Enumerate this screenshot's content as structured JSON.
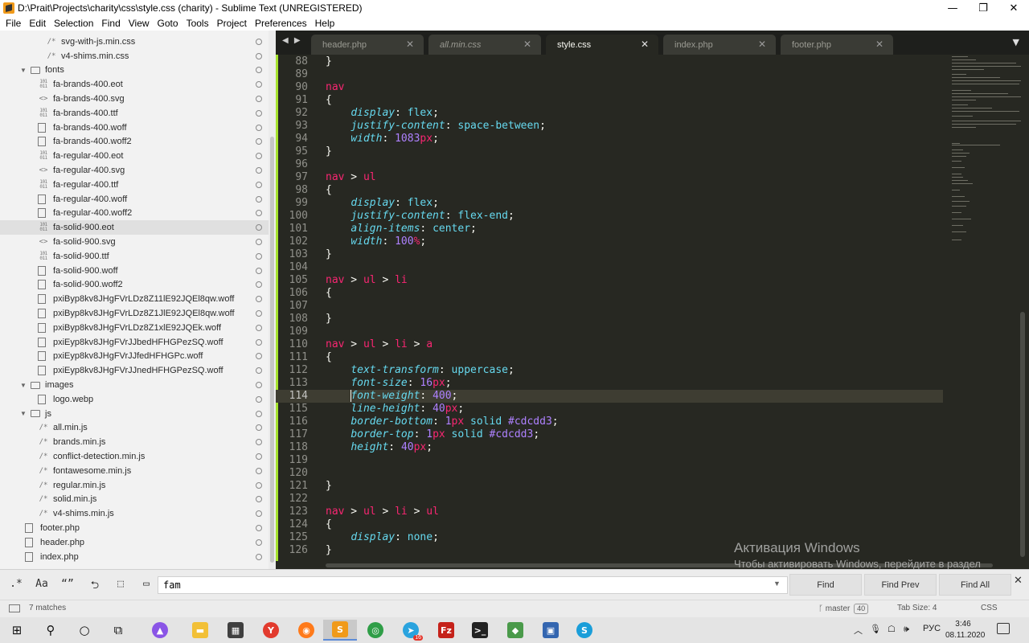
{
  "window": {
    "title": "D:\\Prait\\Projects\\charity\\css\\style.css (charity) - Sublime Text (UNREGISTERED)",
    "controls": [
      {
        "name": "minimize-button",
        "glyph": "—"
      },
      {
        "name": "maximize-button",
        "glyph": "❐"
      },
      {
        "name": "close-window-button",
        "glyph": "✕"
      }
    ]
  },
  "menu": [
    "File",
    "Edit",
    "Selection",
    "Find",
    "View",
    "Goto",
    "Tools",
    "Project",
    "Preferences",
    "Help"
  ],
  "sidebar": {
    "items": [
      {
        "label": "svg-with-js.min.css",
        "icon": "comment-file-icon",
        "glyph": "/*",
        "depth": 3
      },
      {
        "label": "v4-shims.min.css",
        "icon": "comment-file-icon",
        "glyph": "/*",
        "depth": 3
      },
      {
        "label": "fonts",
        "icon": "folder-icon",
        "type": "folder",
        "depth": 1
      },
      {
        "label": "fa-brands-400.eot",
        "icon": "binary-file-icon",
        "type": "bin",
        "depth": 2
      },
      {
        "label": "fa-brands-400.svg",
        "icon": "code-file-icon",
        "glyph": "<>",
        "depth": 2
      },
      {
        "label": "fa-brands-400.ttf",
        "icon": "binary-file-icon",
        "type": "bin",
        "depth": 2
      },
      {
        "label": "fa-brands-400.woff",
        "icon": "file-icon",
        "type": "doc",
        "depth": 2
      },
      {
        "label": "fa-brands-400.woff2",
        "icon": "file-icon",
        "type": "doc",
        "depth": 2
      },
      {
        "label": "fa-regular-400.eot",
        "icon": "binary-file-icon",
        "type": "bin",
        "depth": 2
      },
      {
        "label": "fa-regular-400.svg",
        "icon": "code-file-icon",
        "glyph": "<>",
        "depth": 2
      },
      {
        "label": "fa-regular-400.ttf",
        "icon": "binary-file-icon",
        "type": "bin",
        "depth": 2
      },
      {
        "label": "fa-regular-400.woff",
        "icon": "file-icon",
        "type": "doc",
        "depth": 2
      },
      {
        "label": "fa-regular-400.woff2",
        "icon": "file-icon",
        "type": "doc",
        "depth": 2
      },
      {
        "label": "fa-solid-900.eot",
        "icon": "binary-file-icon",
        "type": "bin",
        "depth": 2,
        "selected": true
      },
      {
        "label": "fa-solid-900.svg",
        "icon": "code-file-icon",
        "glyph": "<>",
        "depth": 2
      },
      {
        "label": "fa-solid-900.ttf",
        "icon": "binary-file-icon",
        "type": "bin",
        "depth": 2
      },
      {
        "label": "fa-solid-900.woff",
        "icon": "file-icon",
        "type": "doc",
        "depth": 2
      },
      {
        "label": "fa-solid-900.woff2",
        "icon": "file-icon",
        "type": "doc",
        "depth": 2
      },
      {
        "label": "pxiByp8kv8JHgFVrLDz8Z11lE92JQEl8qw.woff",
        "icon": "file-icon",
        "type": "doc",
        "depth": 2
      },
      {
        "label": "pxiByp8kv8JHgFVrLDz8Z1JlE92JQEl8qw.woff",
        "icon": "file-icon",
        "type": "doc",
        "depth": 2
      },
      {
        "label": "pxiByp8kv8JHgFVrLDz8Z1xlE92JQEk.woff",
        "icon": "file-icon",
        "type": "doc",
        "depth": 2
      },
      {
        "label": "pxiEyp8kv8JHgFVrJJbedHFHGPezSQ.woff",
        "icon": "file-icon",
        "type": "doc",
        "depth": 2
      },
      {
        "label": "pxiEyp8kv8JHgFVrJJfedHFHGPc.woff",
        "icon": "file-icon",
        "type": "doc",
        "depth": 2
      },
      {
        "label": "pxiEyp8kv8JHgFVrJJnedHFHGPezSQ.woff",
        "icon": "file-icon",
        "type": "doc",
        "depth": 2
      },
      {
        "label": "images",
        "icon": "folder-icon",
        "type": "folder",
        "depth": 1
      },
      {
        "label": "logo.webp",
        "icon": "file-icon",
        "type": "doc",
        "depth": 2
      },
      {
        "label": "js",
        "icon": "folder-icon",
        "type": "folder",
        "depth": 1
      },
      {
        "label": "all.min.js",
        "icon": "comment-file-icon",
        "glyph": "/*",
        "depth": 2
      },
      {
        "label": "brands.min.js",
        "icon": "comment-file-icon",
        "glyph": "/*",
        "depth": 2
      },
      {
        "label": "conflict-detection.min.js",
        "icon": "comment-file-icon",
        "glyph": "/*",
        "depth": 2
      },
      {
        "label": "fontawesome.min.js",
        "icon": "comment-file-icon",
        "glyph": "/*",
        "depth": 2
      },
      {
        "label": "regular.min.js",
        "icon": "comment-file-icon",
        "glyph": "/*",
        "depth": 2
      },
      {
        "label": "solid.min.js",
        "icon": "comment-file-icon",
        "glyph": "/*",
        "depth": 2
      },
      {
        "label": "v4-shims.min.js",
        "icon": "comment-file-icon",
        "glyph": "/*",
        "depth": 2
      },
      {
        "label": "footer.php",
        "icon": "file-icon",
        "type": "doc",
        "depth": 1
      },
      {
        "label": "header.php",
        "icon": "file-icon",
        "type": "doc",
        "depth": 1
      },
      {
        "label": "index.php",
        "icon": "file-icon",
        "type": "doc",
        "depth": 1
      }
    ]
  },
  "tabs": [
    {
      "label": "header.php",
      "active": false,
      "italic": false
    },
    {
      "label": "all.min.css",
      "active": false,
      "italic": true
    },
    {
      "label": "style.css",
      "active": true,
      "italic": false
    },
    {
      "label": "index.php",
      "active": false,
      "italic": false
    },
    {
      "label": "footer.php",
      "active": false,
      "italic": false
    }
  ],
  "tab_nav": "◀ ▶",
  "tab_close_glyph": "✕",
  "tab_dropdown_glyph": "▼",
  "editor": {
    "current_line": "114",
    "lines": [
      {
        "n": "88",
        "t": [
          [
            "p",
            "}"
          ]
        ]
      },
      {
        "n": "89",
        "t": []
      },
      {
        "n": "90",
        "t": [
          [
            "s",
            "nav"
          ]
        ]
      },
      {
        "n": "91",
        "t": [
          [
            "p",
            "{"
          ]
        ]
      },
      {
        "n": "92",
        "t": [
          [
            "p",
            "    "
          ],
          [
            "k",
            "display"
          ],
          [
            "p",
            ": "
          ],
          [
            "v",
            "flex"
          ],
          [
            "p",
            ";"
          ]
        ]
      },
      {
        "n": "93",
        "t": [
          [
            "p",
            "    "
          ],
          [
            "k",
            "justify-content"
          ],
          [
            "p",
            ": "
          ],
          [
            "v",
            "space-between"
          ],
          [
            "p",
            ";"
          ]
        ]
      },
      {
        "n": "94",
        "t": [
          [
            "p",
            "    "
          ],
          [
            "k",
            "width"
          ],
          [
            "p",
            ": "
          ],
          [
            "n",
            "1083"
          ],
          [
            "u",
            "px"
          ],
          [
            "p",
            ";"
          ]
        ]
      },
      {
        "n": "95",
        "t": [
          [
            "p",
            "}"
          ]
        ]
      },
      {
        "n": "96",
        "t": []
      },
      {
        "n": "97",
        "t": [
          [
            "s",
            "nav"
          ],
          [
            "p",
            " > "
          ],
          [
            "s",
            "ul"
          ]
        ]
      },
      {
        "n": "98",
        "t": [
          [
            "p",
            "{"
          ]
        ]
      },
      {
        "n": "99",
        "t": [
          [
            "p",
            "    "
          ],
          [
            "k",
            "display"
          ],
          [
            "p",
            ": "
          ],
          [
            "v",
            "flex"
          ],
          [
            "p",
            ";"
          ]
        ]
      },
      {
        "n": "100",
        "t": [
          [
            "p",
            "    "
          ],
          [
            "k",
            "justify-content"
          ],
          [
            "p",
            ": "
          ],
          [
            "v",
            "flex-end"
          ],
          [
            "p",
            ";"
          ]
        ]
      },
      {
        "n": "101",
        "t": [
          [
            "p",
            "    "
          ],
          [
            "k",
            "align-items"
          ],
          [
            "p",
            ": "
          ],
          [
            "v",
            "center"
          ],
          [
            "p",
            ";"
          ]
        ]
      },
      {
        "n": "102",
        "t": [
          [
            "p",
            "    "
          ],
          [
            "k",
            "width"
          ],
          [
            "p",
            ": "
          ],
          [
            "n",
            "100"
          ],
          [
            "u",
            "%"
          ],
          [
            "p",
            ";"
          ]
        ]
      },
      {
        "n": "103",
        "t": [
          [
            "p",
            "}"
          ]
        ]
      },
      {
        "n": "104",
        "t": []
      },
      {
        "n": "105",
        "t": [
          [
            "s",
            "nav"
          ],
          [
            "p",
            " > "
          ],
          [
            "s",
            "ul"
          ],
          [
            "p",
            " > "
          ],
          [
            "s",
            "li"
          ]
        ]
      },
      {
        "n": "106",
        "t": [
          [
            "p",
            "{"
          ]
        ]
      },
      {
        "n": "107",
        "t": []
      },
      {
        "n": "108",
        "t": [
          [
            "p",
            "}"
          ]
        ]
      },
      {
        "n": "109",
        "t": []
      },
      {
        "n": "110",
        "t": [
          [
            "s",
            "nav"
          ],
          [
            "p",
            " > "
          ],
          [
            "s",
            "ul"
          ],
          [
            "p",
            " > "
          ],
          [
            "s",
            "li"
          ],
          [
            "p",
            " > "
          ],
          [
            "s",
            "a"
          ]
        ]
      },
      {
        "n": "111",
        "t": [
          [
            "p",
            "{"
          ]
        ]
      },
      {
        "n": "112",
        "t": [
          [
            "p",
            "    "
          ],
          [
            "k",
            "text-transform"
          ],
          [
            "p",
            ": "
          ],
          [
            "v",
            "uppercase"
          ],
          [
            "p",
            ";"
          ]
        ]
      },
      {
        "n": "113",
        "t": [
          [
            "p",
            "    "
          ],
          [
            "k",
            "font-size"
          ],
          [
            "p",
            ": "
          ],
          [
            "n",
            "16"
          ],
          [
            "u",
            "px"
          ],
          [
            "p",
            ";"
          ]
        ]
      },
      {
        "n": "114",
        "t": [
          [
            "p",
            "    "
          ],
          [
            "c",
            ""
          ],
          [
            "k",
            "font-weight"
          ],
          [
            "p",
            ": "
          ],
          [
            "n",
            "400"
          ],
          [
            "p",
            ";"
          ]
        ]
      },
      {
        "n": "115",
        "t": [
          [
            "p",
            "    "
          ],
          [
            "k",
            "line-height"
          ],
          [
            "p",
            ": "
          ],
          [
            "n",
            "40"
          ],
          [
            "u",
            "px"
          ],
          [
            "p",
            ";"
          ]
        ]
      },
      {
        "n": "116",
        "t": [
          [
            "p",
            "    "
          ],
          [
            "k",
            "border-bottom"
          ],
          [
            "p",
            ": "
          ],
          [
            "n",
            "1"
          ],
          [
            "u",
            "px"
          ],
          [
            "v",
            " solid "
          ],
          [
            "n",
            "#cdcdd3"
          ],
          [
            "p",
            ";"
          ]
        ]
      },
      {
        "n": "117",
        "t": [
          [
            "p",
            "    "
          ],
          [
            "k",
            "border-top"
          ],
          [
            "p",
            ": "
          ],
          [
            "n",
            "1"
          ],
          [
            "u",
            "px"
          ],
          [
            "v",
            " solid "
          ],
          [
            "n",
            "#cdcdd3"
          ],
          [
            "p",
            ";"
          ]
        ]
      },
      {
        "n": "118",
        "t": [
          [
            "p",
            "    "
          ],
          [
            "k",
            "height"
          ],
          [
            "p",
            ": "
          ],
          [
            "n",
            "40"
          ],
          [
            "u",
            "px"
          ],
          [
            "p",
            ";"
          ]
        ]
      },
      {
        "n": "119",
        "t": []
      },
      {
        "n": "120",
        "t": []
      },
      {
        "n": "121",
        "t": [
          [
            "p",
            "}"
          ]
        ]
      },
      {
        "n": "122",
        "t": []
      },
      {
        "n": "123",
        "t": [
          [
            "s",
            "nav"
          ],
          [
            "p",
            " > "
          ],
          [
            "s",
            "ul"
          ],
          [
            "p",
            " > "
          ],
          [
            "s",
            "li"
          ],
          [
            "p",
            " > "
          ],
          [
            "s",
            "ul"
          ]
        ]
      },
      {
        "n": "124",
        "t": [
          [
            "p",
            "{"
          ]
        ]
      },
      {
        "n": "125",
        "t": [
          [
            "p",
            "    "
          ],
          [
            "k",
            "display"
          ],
          [
            "p",
            ": "
          ],
          [
            "v",
            "none"
          ],
          [
            "p",
            ";"
          ]
        ]
      },
      {
        "n": "126",
        "t": [
          [
            "p",
            "}"
          ]
        ]
      }
    ]
  },
  "activation": {
    "title": "Активация Windows",
    "subtitle": "Чтобы активировать Windows, перейдите в раздел \"Параметры\"."
  },
  "find": {
    "options": [
      {
        "name": "regex-toggle",
        "glyph": ".*"
      },
      {
        "name": "case-toggle",
        "glyph": "Aa"
      },
      {
        "name": "whole-word-toggle",
        "glyph": "“”"
      },
      {
        "name": "wrap-toggle",
        "glyph": "⮌"
      },
      {
        "name": "in-selection-toggle",
        "glyph": "⬚"
      },
      {
        "name": "highlight-toggle",
        "glyph": "▭"
      }
    ],
    "query": "fam",
    "dropdown_glyph": "▼",
    "buttons": [
      "Find",
      "Find Prev",
      "Find All"
    ],
    "close_glyph": "✕"
  },
  "status": {
    "matches": "7 matches",
    "branch": "master",
    "branch_count": "40",
    "branch_glyph": "ᚴ",
    "tab_size": "Tab Size: 4",
    "syntax": "CSS"
  },
  "taskbar": {
    "apps": [
      {
        "name": "start-button",
        "glyph": "⊞",
        "bg": "",
        "style": "plain"
      },
      {
        "name": "search-icon",
        "glyph": "⚲",
        "bg": "",
        "style": "plain"
      },
      {
        "name": "cortana-icon",
        "glyph": "○",
        "bg": "",
        "style": "plain"
      },
      {
        "name": "task-view-icon",
        "glyph": "⧉",
        "bg": "",
        "style": "plain"
      },
      {
        "name": "alice-icon",
        "glyph": "▲",
        "bg": "#8a55e6",
        "style": "circle"
      },
      {
        "name": "file-explorer-icon",
        "glyph": "▬",
        "bg": "#f2c037",
        "style": ""
      },
      {
        "name": "store-icon",
        "glyph": "▦",
        "bg": "#3f3f3f",
        "style": ""
      },
      {
        "name": "yandex-browser-icon",
        "glyph": "Y",
        "bg": "#e23b2e",
        "style": "circle"
      },
      {
        "name": "firefox-icon",
        "glyph": "◉",
        "bg": "#ff7a1a",
        "style": "circle"
      },
      {
        "name": "sublime-text-icon",
        "glyph": "S",
        "bg": "#f09a1a",
        "style": "",
        "active": true
      },
      {
        "name": "chrome-icon",
        "glyph": "◎",
        "bg": "#2f9e47",
        "style": "circle"
      },
      {
        "name": "telegram-icon",
        "glyph": "➤",
        "bg": "#2aa3de",
        "style": "circle",
        "badge": "16"
      },
      {
        "name": "filezilla-icon",
        "glyph": "Fz",
        "bg": "#c5221a",
        "style": ""
      },
      {
        "name": "terminal-icon",
        "glyph": ">_",
        "bg": "#222222",
        "style": ""
      },
      {
        "name": "git-icon",
        "glyph": "◆",
        "bg": "#4a9a4a",
        "style": ""
      },
      {
        "name": "network-app-icon",
        "glyph": "▣",
        "bg": "#3466b0",
        "style": ""
      },
      {
        "name": "skype-icon",
        "glyph": "S",
        "bg": "#1a9ed9",
        "style": "circle"
      }
    ],
    "tray": {
      "chevron": "︿",
      "mic": "🎙",
      "network": "☖",
      "volume": "🕪",
      "language": "РУС",
      "time": "3:46",
      "date": "08.11.2020"
    }
  }
}
